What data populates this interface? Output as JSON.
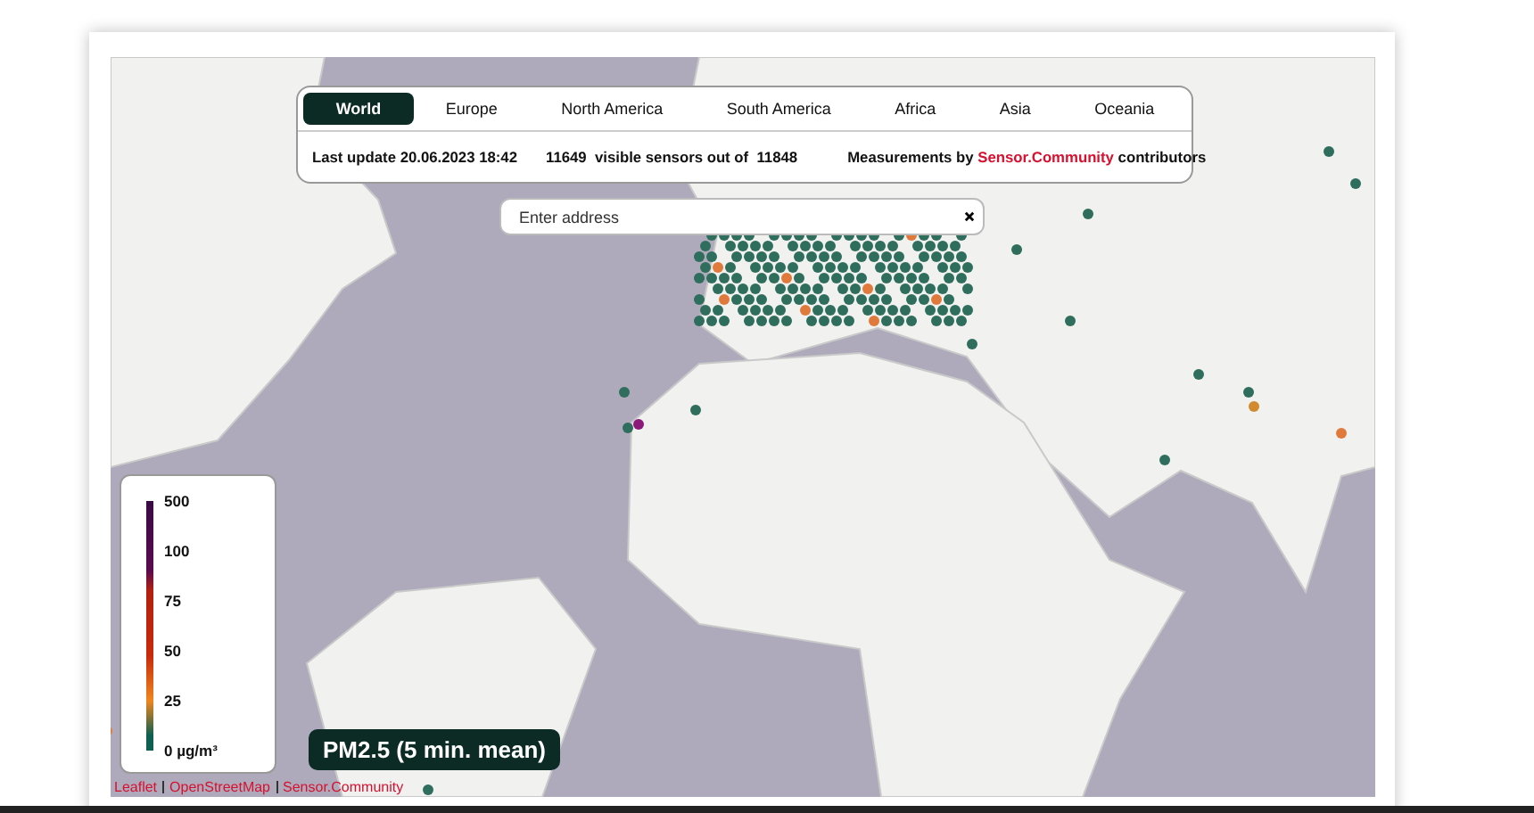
{
  "regions": [
    {
      "label": "World",
      "selected": true
    },
    {
      "label": "Europe",
      "selected": false
    },
    {
      "label": "North America",
      "selected": false
    },
    {
      "label": "South America",
      "selected": false
    },
    {
      "label": "Africa",
      "selected": false
    },
    {
      "label": "Asia",
      "selected": false
    },
    {
      "label": "Oceania",
      "selected": false
    }
  ],
  "info": {
    "last_update": "Last update 20.06.2023 18:42",
    "sensors": "11649  visible sensors out of  11848",
    "credit_prefix": "Measurements by",
    "credit_link": "Sensor.Community",
    "credit_suffix": "contributors"
  },
  "search": {
    "placeholder": "Enter address"
  },
  "legend": {
    "ticks": [
      "500",
      "100",
      "75",
      "50",
      "25",
      "0 µg/m³"
    ]
  },
  "measure_badge": "PM2.5 (5 min. mean)",
  "attribution": [
    {
      "label": "Leaflet"
    },
    {
      "label": "OpenStreetMap"
    },
    {
      "label": "Sensor.Community"
    }
  ]
}
